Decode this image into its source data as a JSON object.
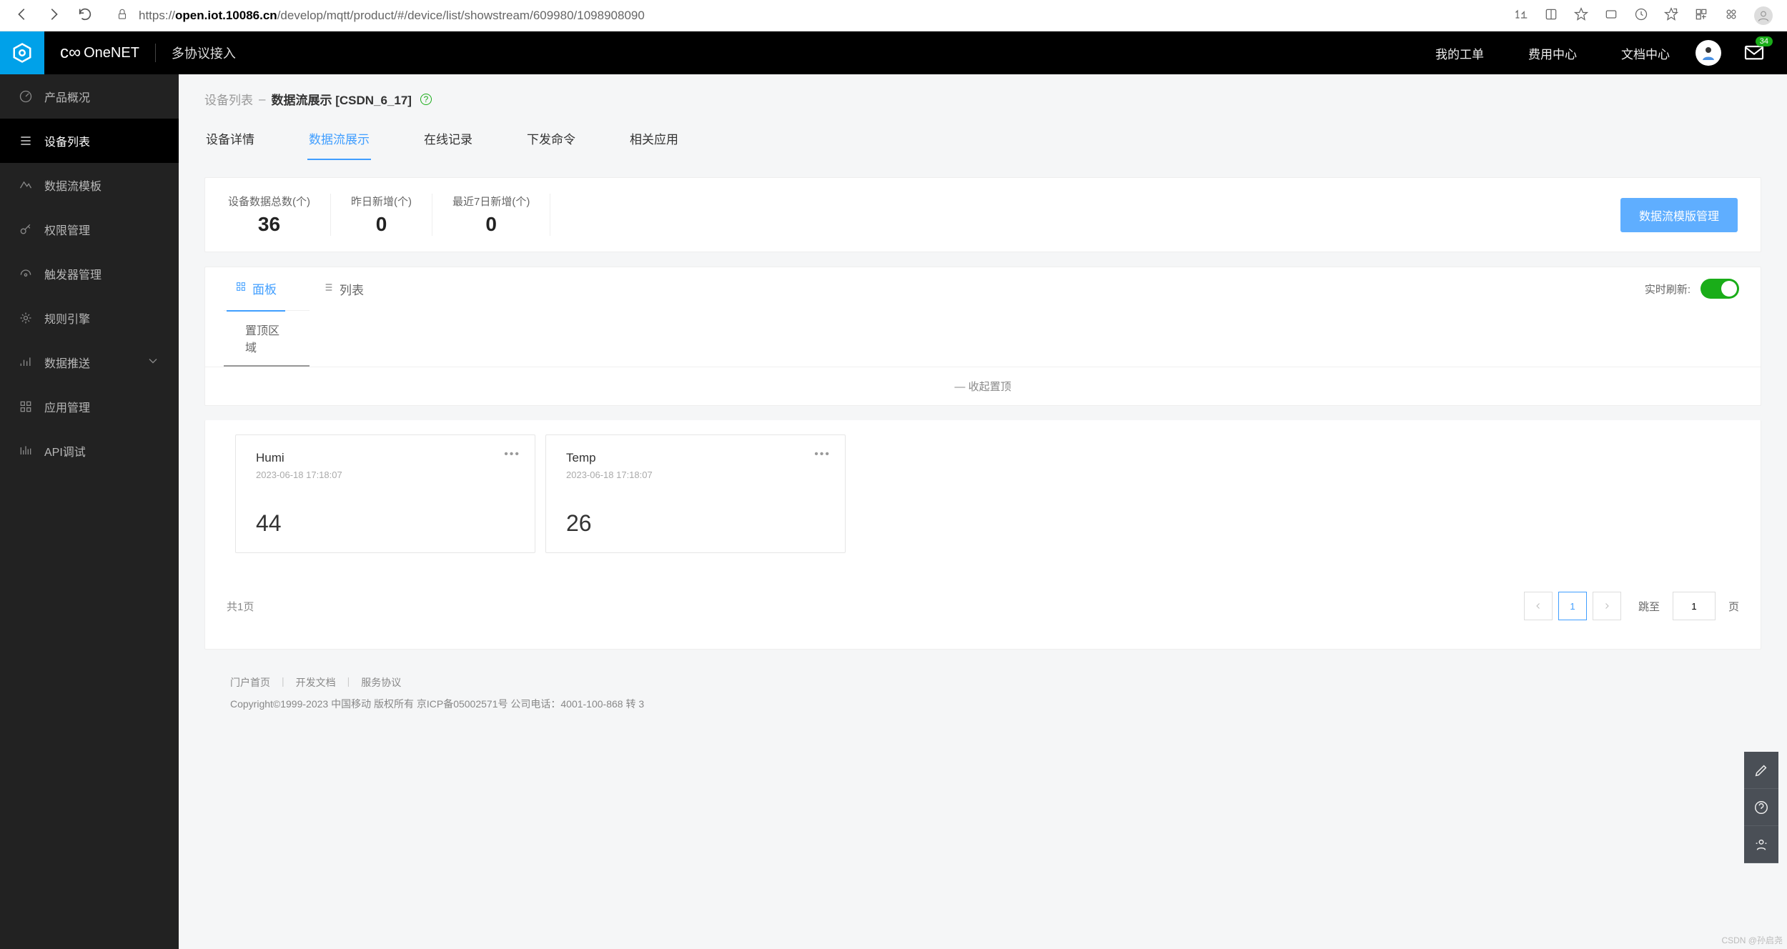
{
  "browser": {
    "url_prefix": "https://",
    "url_host": "open.iot.10086.cn",
    "url_path": "/develop/mqtt/product/#/device/list/showstream/609980/1098908090"
  },
  "header": {
    "brand": "OneNET",
    "subtitle": "多协议接入",
    "menu": [
      "我的工单",
      "费用中心",
      "文档中心"
    ],
    "badge": "34"
  },
  "sidebar": {
    "items": [
      {
        "label": "产品概况"
      },
      {
        "label": "设备列表"
      },
      {
        "label": "数据流模板"
      },
      {
        "label": "权限管理"
      },
      {
        "label": "触发器管理"
      },
      {
        "label": "规则引擎"
      },
      {
        "label": "数据推送"
      },
      {
        "label": "应用管理"
      },
      {
        "label": "API调试"
      }
    ]
  },
  "breadcrumb": {
    "parent": "设备列表",
    "sep": "–",
    "current": "数据流展示 [CSDN_6_17]"
  },
  "tabs": [
    "设备详情",
    "数据流展示",
    "在线记录",
    "下发命令",
    "相关应用"
  ],
  "stats": {
    "items": [
      {
        "label": "设备数据总数(个)",
        "value": "36"
      },
      {
        "label": "昨日新增(个)",
        "value": "0"
      },
      {
        "label": "最近7日新增(个)",
        "value": "0"
      }
    ],
    "button": "数据流模版管理"
  },
  "panel": {
    "tabs": [
      "面板",
      "列表"
    ],
    "refresh_label": "实时刷新:",
    "pin_section": "置顶区域",
    "collapse": "— 收起置顶"
  },
  "cards": [
    {
      "name": "Humi",
      "time": "2023-06-18 17:18:07",
      "value": "44"
    },
    {
      "name": "Temp",
      "time": "2023-06-18 17:18:07",
      "value": "26"
    }
  ],
  "pagination": {
    "total": "共1页",
    "current": "1",
    "jump_label": "跳至",
    "jump_value": "1",
    "jump_suffix": "页"
  },
  "footer": {
    "links": [
      "门户首页",
      "开发文档",
      "服务协议"
    ],
    "copyright": "Copyright©1999-2023 中国移动 版权所有 京ICP备05002571号 公司电话：4001-100-868 转 3"
  },
  "watermark": "CSDN @孙启尧"
}
